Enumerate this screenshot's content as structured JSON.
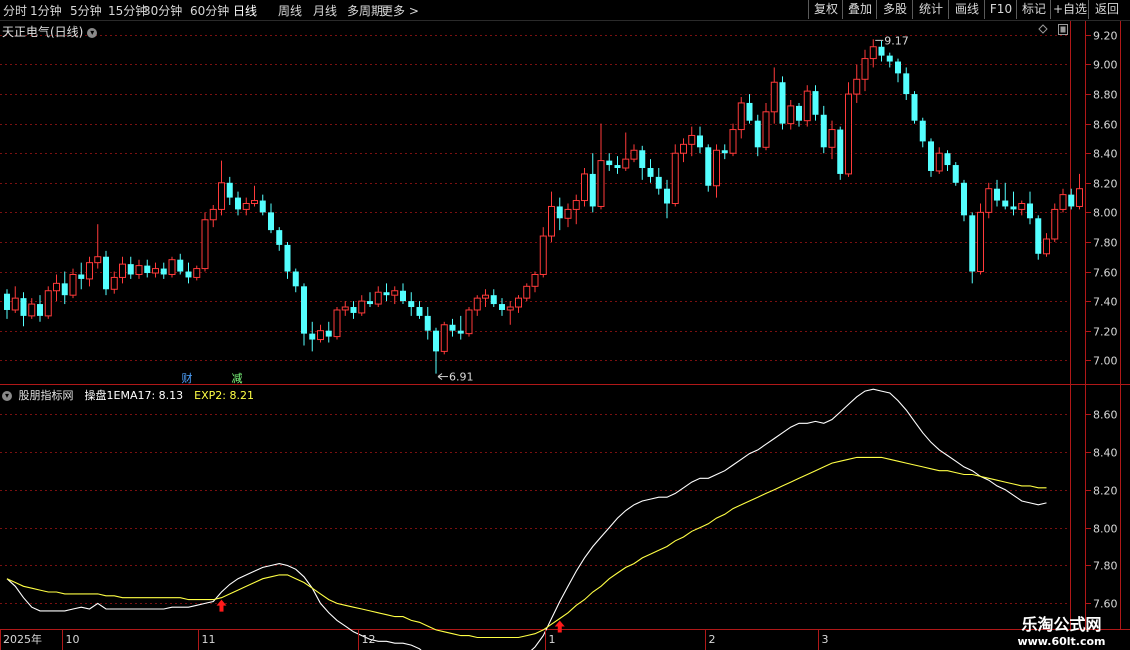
{
  "toolbar": {
    "periods": [
      {
        "label": "分时",
        "active": false
      },
      {
        "label": "1分钟",
        "active": false
      },
      {
        "label": "5分钟",
        "active": false
      },
      {
        "label": "15分钟",
        "active": false
      },
      {
        "label": "30分钟",
        "active": false
      },
      {
        "label": "60分钟",
        "active": false
      },
      {
        "label": "日线",
        "active": true
      },
      {
        "label": "周线",
        "active": false
      },
      {
        "label": "月线",
        "active": false
      },
      {
        "label": "多周期",
        "active": false
      },
      {
        "label": "更多 >",
        "active": false
      }
    ],
    "buttons": [
      "复权",
      "叠加",
      "多股",
      "统计",
      "画线",
      "F10",
      "标记",
      "+自选",
      "返回"
    ]
  },
  "main_chart": {
    "title": "天正电气(日线)",
    "high_label": "9.17",
    "low_label": "6.91",
    "event_markers": [
      {
        "label": "财",
        "color": "#4fa3ff"
      },
      {
        "label": "减",
        "color": "#7fff7f"
      }
    ]
  },
  "indicator": {
    "name": "股朋指标网",
    "formula_label": "操盘1EMA17:",
    "ema_value": "8.13",
    "exp_label": "EXP2:",
    "exp_value": "8.21"
  },
  "x_axis": {
    "year": "2025年",
    "months": [
      "10",
      "11",
      "12",
      "1",
      "2",
      "3"
    ]
  },
  "watermark": {
    "line1": "乐淘公式网",
    "line2": "www.60lt.com"
  },
  "colors": {
    "up": "#ff3a3a",
    "down": "#54ffff",
    "ema": "#ffffff",
    "exp": "#ffff44",
    "grid": "#7a1010",
    "arrow": "#ff1a1a"
  },
  "chart_data": [
    {
      "type": "candlestick",
      "title": "天正电气(日线)",
      "y_ticks": [
        7.0,
        7.2,
        7.4,
        7.6,
        7.8,
        8.0,
        8.2,
        8.4,
        8.6,
        8.8,
        9.0,
        9.2
      ],
      "ylim": [
        6.88,
        9.24
      ],
      "ohlc": [
        [
          7.45,
          7.48,
          7.28,
          7.34
        ],
        [
          7.34,
          7.5,
          7.32,
          7.42
        ],
        [
          7.42,
          7.46,
          7.23,
          7.3
        ],
        [
          7.3,
          7.42,
          7.28,
          7.38
        ],
        [
          7.38,
          7.44,
          7.26,
          7.3
        ],
        [
          7.3,
          7.5,
          7.28,
          7.47
        ],
        [
          7.47,
          7.58,
          7.4,
          7.52
        ],
        [
          7.52,
          7.6,
          7.38,
          7.44
        ],
        [
          7.44,
          7.62,
          7.42,
          7.58
        ],
        [
          7.58,
          7.66,
          7.48,
          7.55
        ],
        [
          7.55,
          7.7,
          7.5,
          7.66
        ],
        [
          7.66,
          7.92,
          7.62,
          7.7
        ],
        [
          7.7,
          7.74,
          7.44,
          7.48
        ],
        [
          7.48,
          7.6,
          7.45,
          7.56
        ],
        [
          7.56,
          7.7,
          7.52,
          7.65
        ],
        [
          7.65,
          7.7,
          7.55,
          7.58
        ],
        [
          7.58,
          7.68,
          7.55,
          7.64
        ],
        [
          7.64,
          7.68,
          7.56,
          7.59
        ],
        [
          7.59,
          7.66,
          7.56,
          7.62
        ],
        [
          7.62,
          7.66,
          7.55,
          7.58
        ],
        [
          7.58,
          7.7,
          7.56,
          7.68
        ],
        [
          7.68,
          7.72,
          7.58,
          7.6
        ],
        [
          7.6,
          7.66,
          7.52,
          7.56
        ],
        [
          7.56,
          7.64,
          7.54,
          7.62
        ],
        [
          7.62,
          8.0,
          7.6,
          7.95
        ],
        [
          7.95,
          8.05,
          7.9,
          8.02
        ],
        [
          8.02,
          8.35,
          7.98,
          8.2
        ],
        [
          8.2,
          8.24,
          8.05,
          8.1
        ],
        [
          8.1,
          8.14,
          7.98,
          8.02
        ],
        [
          8.02,
          8.1,
          7.98,
          8.06
        ],
        [
          8.06,
          8.18,
          8.04,
          8.08
        ],
        [
          8.08,
          8.12,
          7.98,
          8.0
        ],
        [
          8.0,
          8.06,
          7.86,
          7.88
        ],
        [
          7.88,
          7.9,
          7.74,
          7.78
        ],
        [
          7.78,
          7.8,
          7.55,
          7.6
        ],
        [
          7.6,
          7.62,
          7.46,
          7.5
        ],
        [
          7.5,
          7.52,
          7.1,
          7.18
        ],
        [
          7.18,
          7.26,
          7.06,
          7.14
        ],
        [
          7.14,
          7.24,
          7.12,
          7.2
        ],
        [
          7.2,
          7.26,
          7.12,
          7.16
        ],
        [
          7.16,
          7.36,
          7.14,
          7.34
        ],
        [
          7.34,
          7.4,
          7.3,
          7.36
        ],
        [
          7.36,
          7.4,
          7.28,
          7.32
        ],
        [
          7.32,
          7.44,
          7.3,
          7.4
        ],
        [
          7.4,
          7.46,
          7.36,
          7.38
        ],
        [
          7.38,
          7.5,
          7.36,
          7.46
        ],
        [
          7.46,
          7.52,
          7.4,
          7.44
        ],
        [
          7.44,
          7.5,
          7.38,
          7.47
        ],
        [
          7.47,
          7.52,
          7.38,
          7.4
        ],
        [
          7.4,
          7.46,
          7.3,
          7.36
        ],
        [
          7.36,
          7.4,
          7.28,
          7.3
        ],
        [
          7.3,
          7.36,
          7.14,
          7.2
        ],
        [
          7.2,
          7.22,
          6.91,
          7.06
        ],
        [
          7.06,
          7.26,
          7.04,
          7.24
        ],
        [
          7.24,
          7.28,
          7.16,
          7.2
        ],
        [
          7.2,
          7.3,
          7.14,
          7.18
        ],
        [
          7.18,
          7.36,
          7.16,
          7.34
        ],
        [
          7.34,
          7.44,
          7.3,
          7.42
        ],
        [
          7.42,
          7.48,
          7.36,
          7.44
        ],
        [
          7.44,
          7.48,
          7.36,
          7.38
        ],
        [
          7.38,
          7.42,
          7.3,
          7.34
        ],
        [
          7.34,
          7.4,
          7.24,
          7.36
        ],
        [
          7.36,
          7.44,
          7.32,
          7.42
        ],
        [
          7.42,
          7.52,
          7.4,
          7.5
        ],
        [
          7.5,
          7.6,
          7.46,
          7.58
        ],
        [
          7.58,
          7.9,
          7.56,
          7.84
        ],
        [
          7.84,
          8.14,
          7.8,
          8.04
        ],
        [
          8.04,
          8.1,
          7.88,
          7.96
        ],
        [
          7.96,
          8.06,
          7.9,
          8.02
        ],
        [
          8.02,
          8.12,
          7.92,
          8.08
        ],
        [
          8.08,
          8.3,
          8.04,
          8.26
        ],
        [
          8.26,
          8.4,
          8.0,
          8.04
        ],
        [
          8.04,
          8.6,
          8.02,
          8.35
        ],
        [
          8.35,
          8.4,
          8.28,
          8.32
        ],
        [
          8.32,
          8.38,
          8.26,
          8.3
        ],
        [
          8.3,
          8.54,
          8.28,
          8.36
        ],
        [
          8.36,
          8.46,
          8.34,
          8.42
        ],
        [
          8.42,
          8.45,
          8.22,
          8.3
        ],
        [
          8.3,
          8.36,
          8.2,
          8.24
        ],
        [
          8.24,
          8.3,
          8.12,
          8.16
        ],
        [
          8.16,
          8.22,
          7.96,
          8.06
        ],
        [
          8.06,
          8.46,
          8.04,
          8.4
        ],
        [
          8.4,
          8.5,
          8.34,
          8.46
        ],
        [
          8.46,
          8.58,
          8.38,
          8.52
        ],
        [
          8.52,
          8.58,
          8.4,
          8.44
        ],
        [
          8.44,
          8.46,
          8.14,
          8.18
        ],
        [
          8.18,
          8.46,
          8.1,
          8.42
        ],
        [
          8.42,
          8.46,
          8.36,
          8.4
        ],
        [
          8.4,
          8.6,
          8.38,
          8.56
        ],
        [
          8.56,
          8.78,
          8.5,
          8.74
        ],
        [
          8.74,
          8.8,
          8.6,
          8.62
        ],
        [
          8.62,
          8.66,
          8.38,
          8.44
        ],
        [
          8.44,
          8.74,
          8.42,
          8.68
        ],
        [
          8.68,
          8.98,
          8.6,
          8.88
        ],
        [
          8.88,
          8.92,
          8.56,
          8.6
        ],
        [
          8.6,
          8.76,
          8.56,
          8.72
        ],
        [
          8.72,
          8.74,
          8.58,
          8.62
        ],
        [
          8.62,
          8.86,
          8.58,
          8.82
        ],
        [
          8.82,
          8.86,
          8.62,
          8.66
        ],
        [
          8.66,
          8.72,
          8.4,
          8.44
        ],
        [
          8.44,
          8.62,
          8.36,
          8.56
        ],
        [
          8.56,
          8.58,
          8.22,
          8.26
        ],
        [
          8.26,
          8.88,
          8.24,
          8.8
        ],
        [
          8.8,
          9.0,
          8.74,
          8.9
        ],
        [
          8.9,
          9.1,
          8.82,
          9.04
        ],
        [
          9.04,
          9.17,
          8.98,
          9.12
        ],
        [
          9.12,
          9.16,
          9.02,
          9.06
        ],
        [
          9.06,
          9.08,
          8.98,
          9.02
        ],
        [
          9.02,
          9.04,
          8.88,
          8.94
        ],
        [
          8.94,
          8.98,
          8.76,
          8.8
        ],
        [
          8.8,
          8.82,
          8.6,
          8.62
        ],
        [
          8.62,
          8.64,
          8.44,
          8.48
        ],
        [
          8.48,
          8.5,
          8.24,
          8.28
        ],
        [
          8.28,
          8.44,
          8.26,
          8.4
        ],
        [
          8.4,
          8.42,
          8.28,
          8.32
        ],
        [
          8.32,
          8.34,
          8.18,
          8.2
        ],
        [
          8.2,
          8.22,
          7.94,
          7.98
        ],
        [
          7.98,
          8.0,
          7.52,
          7.6
        ],
        [
          7.6,
          8.06,
          7.58,
          8.0
        ],
        [
          8.0,
          8.2,
          7.96,
          8.16
        ],
        [
          8.16,
          8.22,
          8.04,
          8.08
        ],
        [
          8.08,
          8.2,
          8.02,
          8.04
        ],
        [
          8.04,
          8.14,
          7.98,
          8.02
        ],
        [
          8.02,
          8.08,
          7.98,
          8.06
        ],
        [
          8.06,
          8.14,
          7.92,
          7.96
        ],
        [
          7.96,
          7.98,
          7.68,
          7.72
        ],
        [
          7.72,
          7.86,
          7.7,
          7.82
        ],
        [
          7.82,
          8.06,
          7.8,
          8.02
        ],
        [
          8.02,
          8.16,
          8.0,
          8.12
        ],
        [
          8.12,
          8.16,
          8.02,
          8.04
        ],
        [
          8.04,
          8.26,
          8.02,
          8.16
        ]
      ]
    },
    {
      "type": "line",
      "title": "股朋指标网",
      "y_ticks": [
        7.6,
        7.8,
        8.0,
        8.2,
        8.4,
        8.6
      ],
      "ylim": [
        7.47,
        8.71
      ],
      "series": [
        {
          "name": "操盘1EMA17",
          "color": "#ffffff",
          "values": [
            7.73,
            7.69,
            7.63,
            7.58,
            7.56,
            7.56,
            7.56,
            7.56,
            7.57,
            7.58,
            7.57,
            7.6,
            7.57,
            7.57,
            7.57,
            7.57,
            7.57,
            7.57,
            7.57,
            7.57,
            7.58,
            7.58,
            7.58,
            7.59,
            7.6,
            7.61,
            7.66,
            7.7,
            7.73,
            7.75,
            7.77,
            7.79,
            7.8,
            7.81,
            7.8,
            7.78,
            7.74,
            7.68,
            7.6,
            7.55,
            7.51,
            7.48,
            7.45,
            7.43,
            7.41,
            7.4,
            7.4,
            7.39,
            7.39,
            7.38,
            7.36,
            7.32,
            7.29,
            7.28,
            7.26,
            7.26,
            7.27,
            7.29,
            7.3,
            7.3,
            7.3,
            7.3,
            7.31,
            7.33,
            7.37,
            7.43,
            7.52,
            7.61,
            7.69,
            7.77,
            7.84,
            7.9,
            7.95,
            8.0,
            8.05,
            8.09,
            8.12,
            8.14,
            8.15,
            8.16,
            8.16,
            8.18,
            8.21,
            8.24,
            8.26,
            8.26,
            8.28,
            8.3,
            8.33,
            8.36,
            8.39,
            8.41,
            8.44,
            8.47,
            8.5,
            8.53,
            8.55,
            8.55,
            8.56,
            8.55,
            8.57,
            8.61,
            8.65,
            8.69,
            8.72,
            8.73,
            8.72,
            8.71,
            8.67,
            8.62,
            8.56,
            8.5,
            8.45,
            8.41,
            8.38,
            8.35,
            8.32,
            8.3,
            8.27,
            8.25,
            8.22,
            8.2,
            8.17,
            8.14,
            8.13,
            8.12,
            8.13
          ]
        },
        {
          "name": "EXP2",
          "color": "#ffff44",
          "values": [
            7.73,
            7.71,
            7.69,
            7.68,
            7.67,
            7.66,
            7.66,
            7.65,
            7.65,
            7.65,
            7.65,
            7.65,
            7.64,
            7.64,
            7.63,
            7.63,
            7.63,
            7.63,
            7.63,
            7.63,
            7.63,
            7.63,
            7.62,
            7.62,
            7.62,
            7.62,
            7.63,
            7.65,
            7.67,
            7.69,
            7.71,
            7.73,
            7.74,
            7.75,
            7.75,
            7.73,
            7.71,
            7.68,
            7.65,
            7.62,
            7.6,
            7.59,
            7.58,
            7.57,
            7.56,
            7.55,
            7.54,
            7.53,
            7.53,
            7.51,
            7.5,
            7.48,
            7.46,
            7.45,
            7.44,
            7.43,
            7.43,
            7.42,
            7.42,
            7.42,
            7.42,
            7.42,
            7.42,
            7.43,
            7.44,
            7.46,
            7.49,
            7.52,
            7.55,
            7.59,
            7.62,
            7.66,
            7.69,
            7.73,
            7.76,
            7.79,
            7.81,
            7.84,
            7.86,
            7.88,
            7.9,
            7.93,
            7.95,
            7.98,
            8.0,
            8.02,
            8.05,
            8.07,
            8.1,
            8.12,
            8.14,
            8.16,
            8.18,
            8.2,
            8.22,
            8.24,
            8.26,
            8.28,
            8.3,
            8.32,
            8.34,
            8.35,
            8.36,
            8.37,
            8.37,
            8.37,
            8.37,
            8.36,
            8.35,
            8.34,
            8.33,
            8.32,
            8.31,
            8.3,
            8.3,
            8.29,
            8.28,
            8.28,
            8.27,
            8.26,
            8.25,
            8.24,
            8.23,
            8.22,
            8.22,
            8.21,
            8.21
          ]
        }
      ],
      "signal_arrows_index": [
        26,
        67
      ]
    }
  ]
}
